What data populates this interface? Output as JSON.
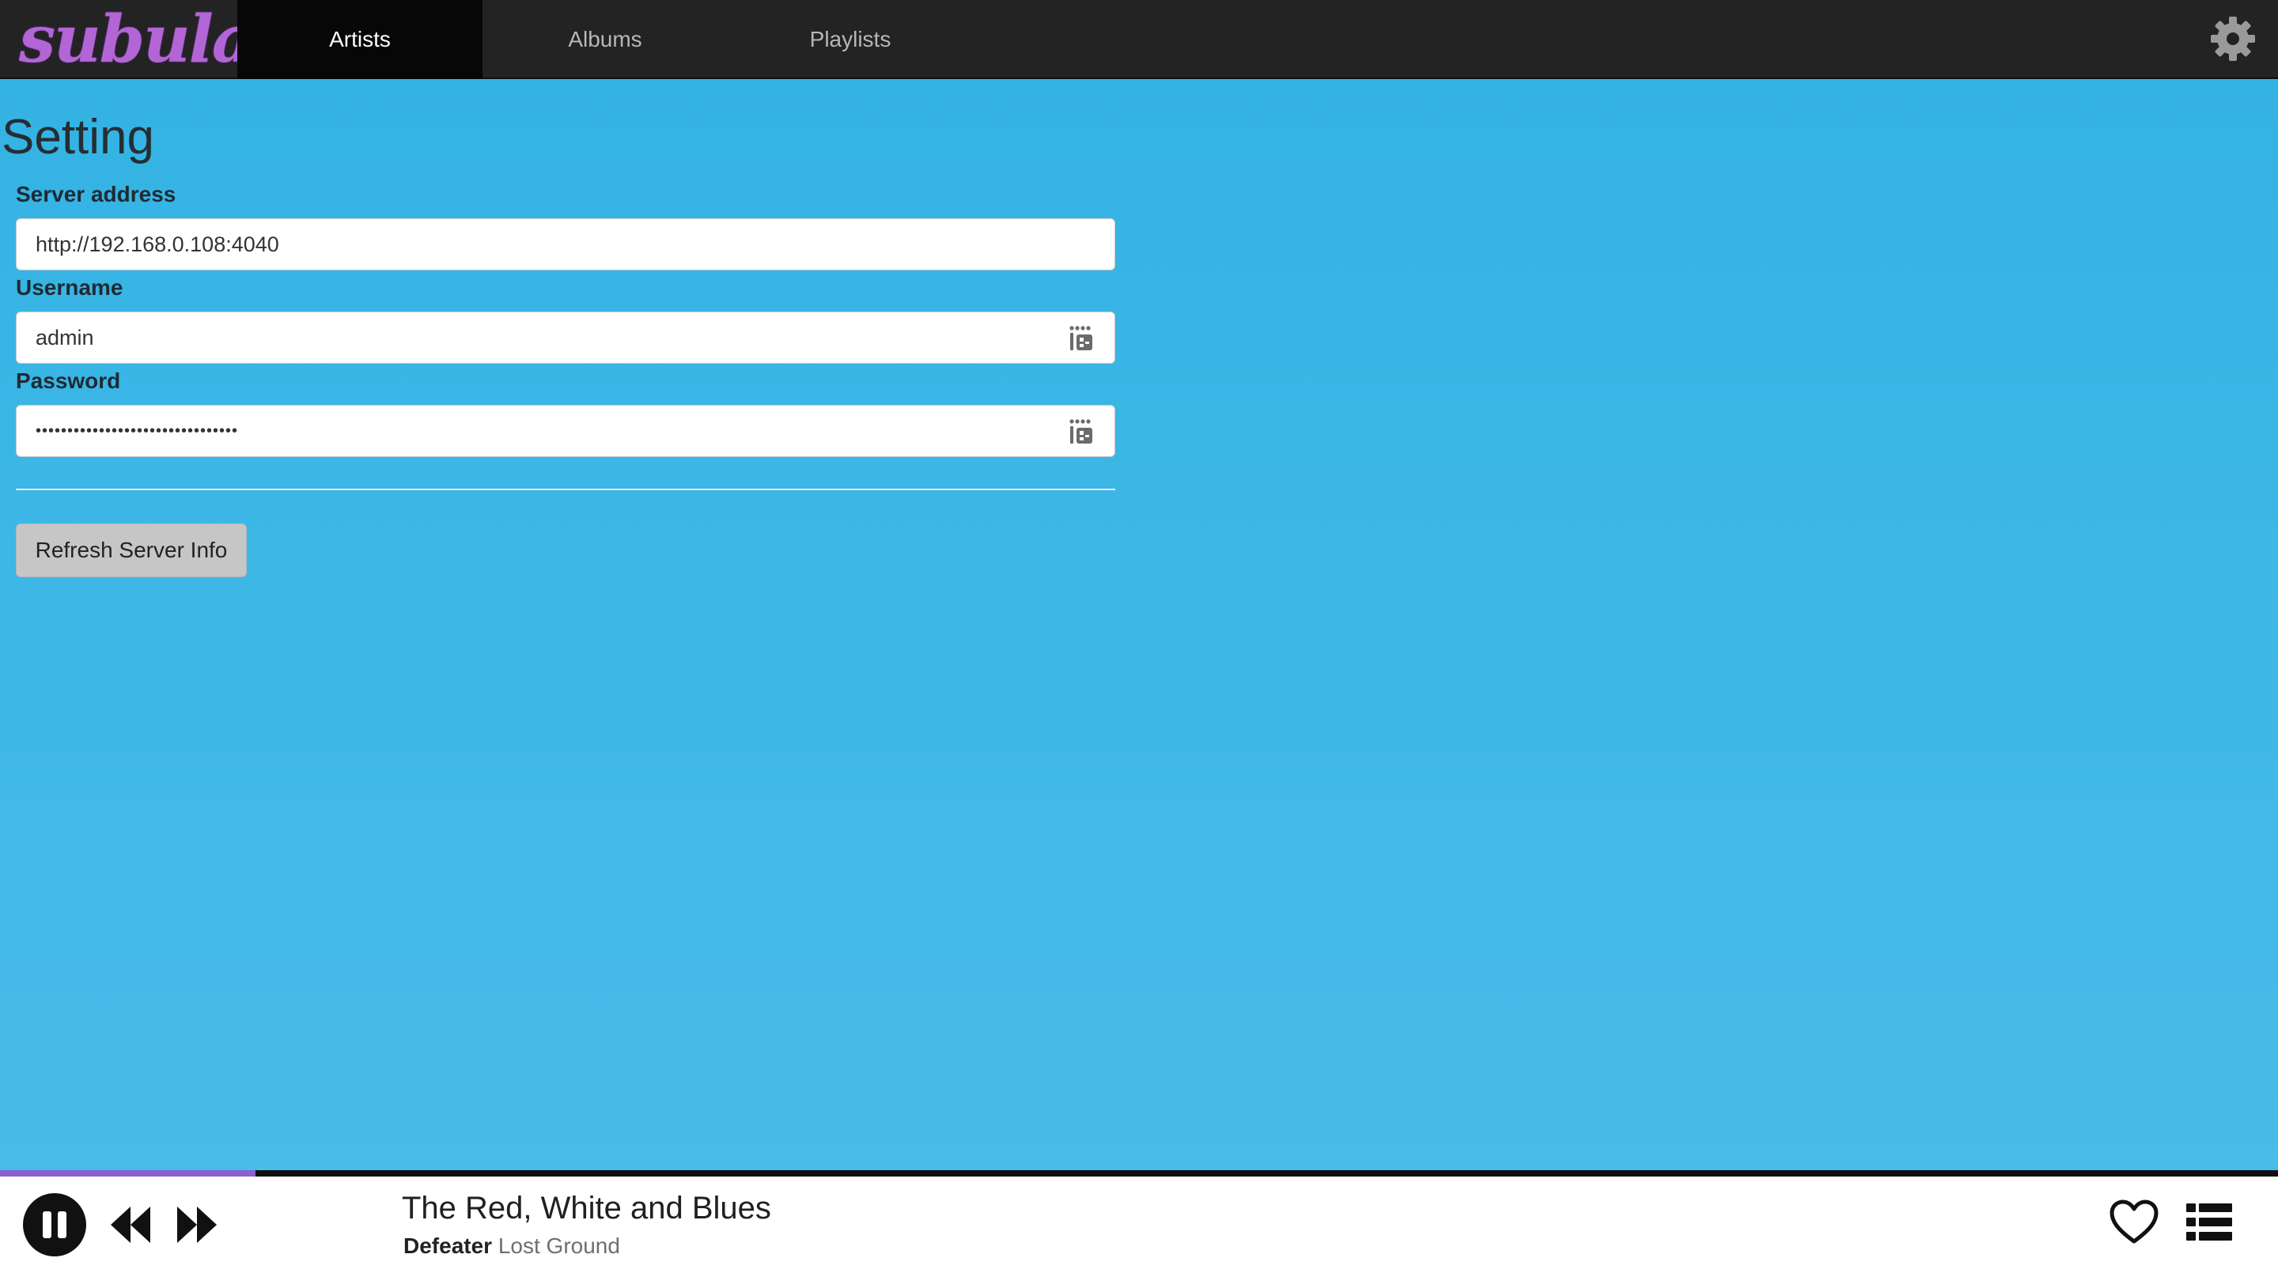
{
  "app": {
    "logo_text": "subular",
    "colors": {
      "accent": "#b266d6",
      "background": "#33b3e3",
      "topbar": "#232323"
    }
  },
  "nav": {
    "tabs": [
      {
        "label": "Artists",
        "active": true
      },
      {
        "label": "Albums",
        "active": false
      },
      {
        "label": "Playlists",
        "active": false
      }
    ],
    "settings_icon": "gear-icon"
  },
  "settings": {
    "title": "Setting",
    "server": {
      "label": "Server address",
      "value": "http://192.168.0.108:4040"
    },
    "username": {
      "label": "Username",
      "value": "admin",
      "icon": "password-manager-icon"
    },
    "password": {
      "label": "Password",
      "value": "••••••••••••••••••••••••••••••••",
      "icon": "password-manager-icon"
    },
    "refresh_button": "Refresh Server Info"
  },
  "player": {
    "progress": 0.112,
    "track_title": "The Red, White and Blues",
    "artist": "Defeater",
    "album": "Lost Ground",
    "icons": [
      "pause-icon",
      "previous-icon",
      "next-icon",
      "heart-icon",
      "queue-list-icon"
    ]
  }
}
